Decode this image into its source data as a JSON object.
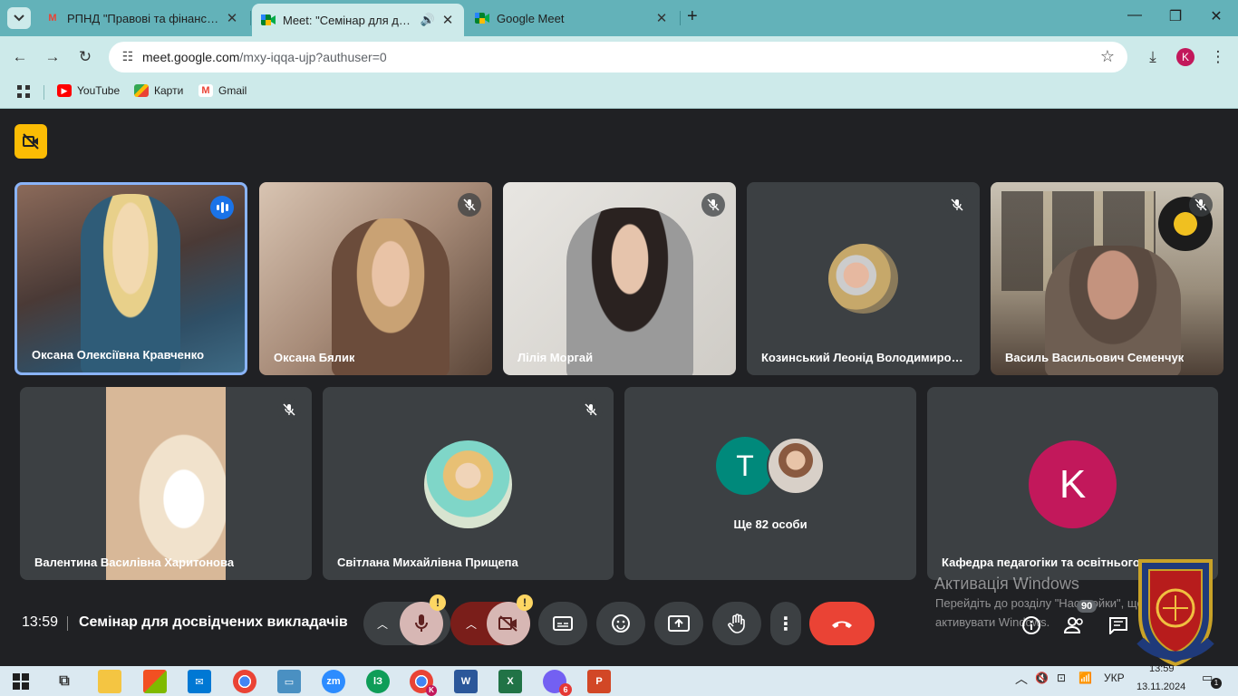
{
  "tabs": [
    {
      "title": "РПНД \"Правові та фінансово-",
      "favicon": "gmail-icon"
    },
    {
      "title": "Meet: \"Семінар для досвідч",
      "favicon": "meet-icon",
      "active": true
    },
    {
      "title": "Google Meet",
      "favicon": "meet-icon"
    }
  ],
  "new_tab": "+",
  "address": {
    "host": "meet.google.com",
    "path": "/mxy-iqqa-ujp?authuser=0"
  },
  "profile_initial": "K",
  "bookmarks": [
    {
      "label": "YouTube",
      "icon": "youtube-icon"
    },
    {
      "label": "Карти",
      "icon": "maps-icon"
    },
    {
      "label": "Gmail",
      "icon": "gmail-icon"
    }
  ],
  "participants": [
    {
      "name": "Оксана Олексіївна Кравченко",
      "speaking": true
    },
    {
      "name": "Оксана Бялик",
      "muted": true
    },
    {
      "name": "Лілія Моргай",
      "muted": true
    },
    {
      "name": "Козинський Леонід Володимирович",
      "muted": true
    },
    {
      "name": "Василь Васильович Семенчук",
      "muted": true
    },
    {
      "name": "Валентина Василівна Харитонова",
      "muted": true
    },
    {
      "name": "Світлана Михайлівна Прищепа",
      "muted": true
    },
    {
      "name": "Ще 82 особи",
      "initial": "T"
    },
    {
      "name": "Кафедра педагогіки та освітнього мене...",
      "initial": "K"
    }
  ],
  "watermark": {
    "line1": "Активація Windows",
    "line2": "Перейдіть до розділу \"Настройки\", щоб",
    "line3": "активувати Windows."
  },
  "meeting": {
    "time": "13:59",
    "title": "Семінар для досвідчених викладачів",
    "people_count": "90"
  },
  "controls": {
    "warning_mark": "!"
  },
  "taskbar": {
    "chrome_badge": "K",
    "viber_badge": "6",
    "lang": "УКР",
    "time": "13:59",
    "date": "13.11.2024",
    "notif_count": "1"
  },
  "colors": {
    "accent_blue": "#8ab4f8",
    "leave_red": "#ea4335",
    "meet_bg": "#202124",
    "tile_bg": "#3c4043",
    "warning_yellow": "#fbbc04",
    "chrome_teal": "#63b2b9"
  }
}
